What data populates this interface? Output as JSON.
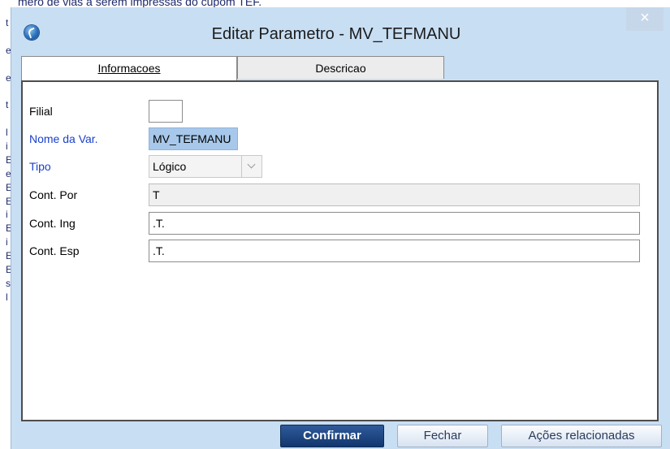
{
  "background": {
    "top_text": "mero de vias a serem impressas do cupom TEF.",
    "left_column_chars": [
      "t",
      "",
      "e",
      "",
      "e",
      "",
      "t",
      "",
      "l",
      "i",
      "E",
      "e",
      "E",
      "E",
      "i",
      "E",
      "i",
      "E",
      "E",
      "s",
      "l"
    ]
  },
  "dialog": {
    "title": "Editar Parametro - MV_TEFMANU",
    "close_glyph": "×",
    "icon": "app-logo-icon"
  },
  "tabs": [
    {
      "label": "Informacoes",
      "active": true
    },
    {
      "label": "Descricao",
      "active": false
    }
  ],
  "form": {
    "filial": {
      "label": "Filial",
      "value": ""
    },
    "nome_var": {
      "label": "Nome da Var.",
      "value": "MV_TEFMANU"
    },
    "tipo": {
      "label": "Tipo",
      "value": "Lógico",
      "icon": "chevron-down-icon"
    },
    "cont_por": {
      "label": "Cont. Por",
      "value": "T"
    },
    "cont_ing": {
      "label": "Cont. Ing",
      "value": ".T."
    },
    "cont_esp": {
      "label": "Cont. Esp",
      "value": ".T."
    }
  },
  "footer": {
    "confirm_label": "Confirmar",
    "close_label": "Fechar",
    "actions_label": "Ações relacionadas"
  },
  "colors": {
    "dialog_bg": "#c8def3",
    "required_label": "#1a3fcc",
    "primary_button": "#1d447f"
  }
}
